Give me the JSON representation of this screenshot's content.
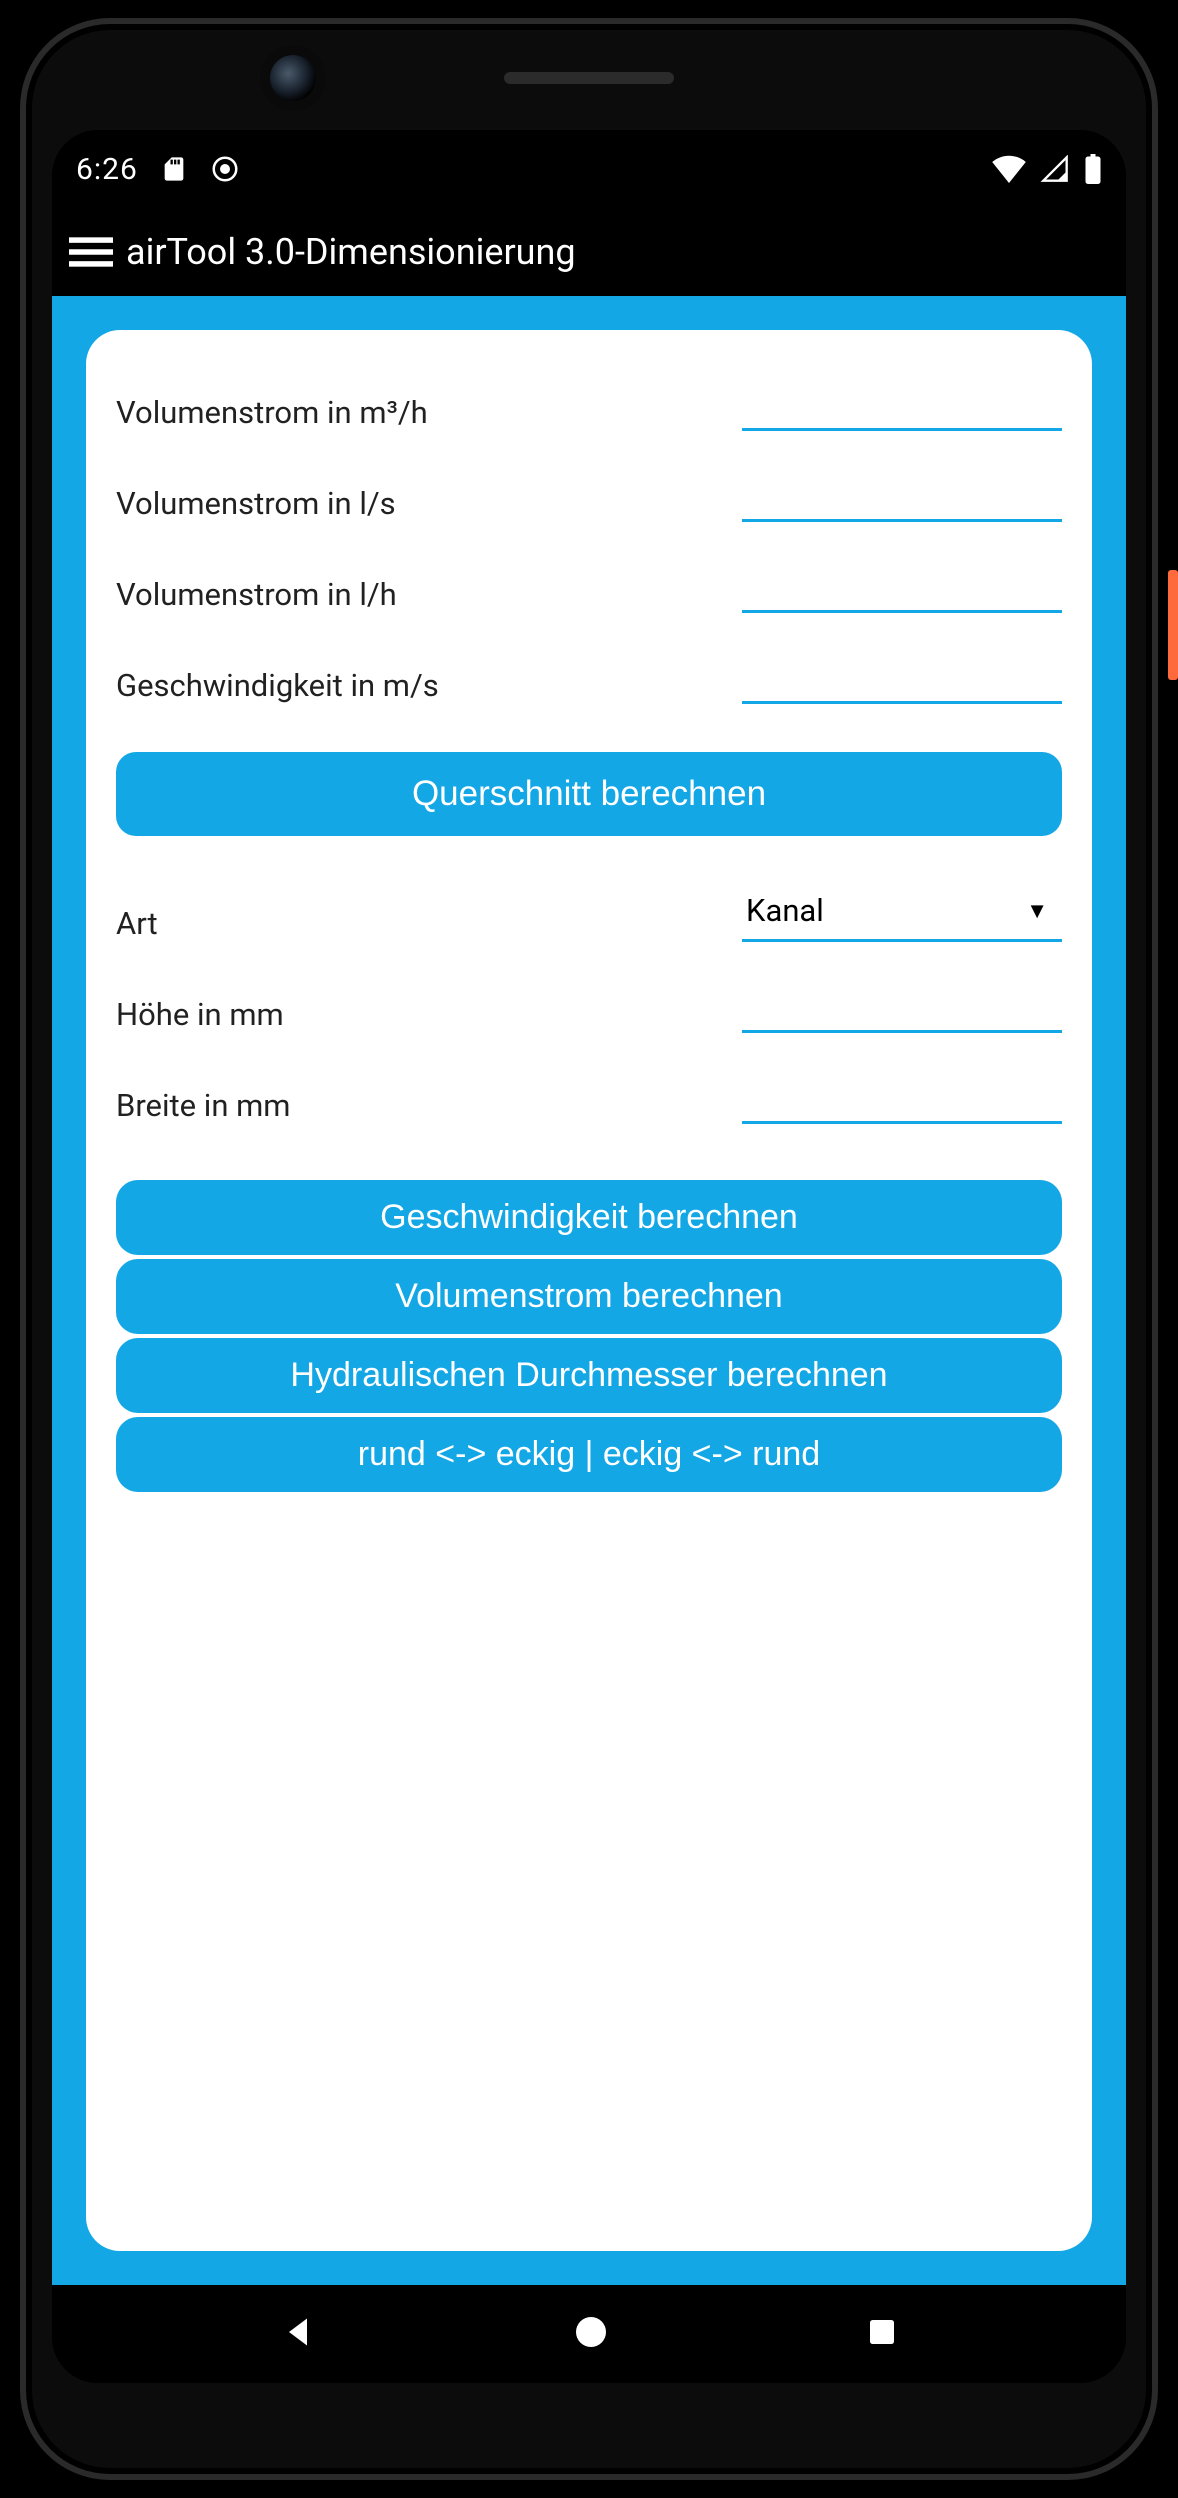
{
  "status": {
    "time": "6:26"
  },
  "appbar": {
    "title": "airTool 3.0-Dimensionierung"
  },
  "fields": {
    "vol_m3h": {
      "label": "Volumenstrom in m³/h",
      "value": ""
    },
    "vol_ls": {
      "label": "Volumenstrom in l/s",
      "value": ""
    },
    "vol_lh": {
      "label": "Volumenstrom in l/h",
      "value": ""
    },
    "speed": {
      "label": "Geschwindigkeit in m/s",
      "value": ""
    },
    "art": {
      "label": "Art",
      "selected": "Kanal"
    },
    "height": {
      "label": "Höhe in mm",
      "value": ""
    },
    "width": {
      "label": "Breite in mm",
      "value": ""
    }
  },
  "buttons": {
    "calc_cross": "Querschnitt berechnen",
    "calc_speed": "Geschwindigkeit berechnen",
    "calc_flow": "Volumenstrom berechnen",
    "calc_hyd": "Hydraulischen Durchmesser berechnen",
    "convert": "rund <-> eckig | eckig <-> rund"
  },
  "colors": {
    "accent": "#14a7e6"
  }
}
